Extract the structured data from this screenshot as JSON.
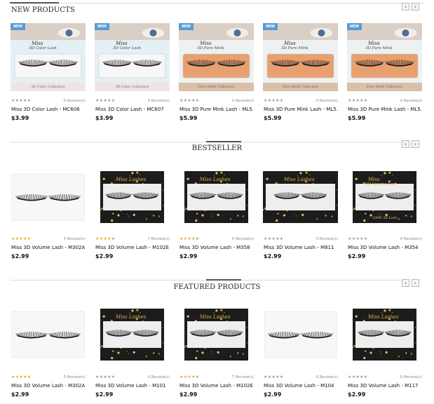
{
  "colors": {
    "badge": "#5a9ad6",
    "star_on": "#f5a623",
    "star_off": "#9a9a9a",
    "pkg_peach": "#e8a071",
    "gold": "#c79a2a"
  },
  "icons": {
    "prev": "‹",
    "next": "›",
    "star": "★"
  },
  "sections": [
    {
      "title": "NEW PRODUCTS",
      "products": [
        {
          "badge": "NEW",
          "brand": "Miss",
          "line": "3D Color Lash",
          "caption": "3D Color Collection",
          "rating": 0,
          "reviews": "0 Review(s)",
          "name": "Miss 3D Color Lash - MC608",
          "price": "$3.99"
        },
        {
          "badge": "NEW",
          "brand": "Miss",
          "line": "3D Color Lash",
          "caption": "3D Color Collection",
          "rating": 0,
          "reviews": "0 Review(s)",
          "name": "Miss 3D Color Lash - MC607",
          "price": "$3.99"
        },
        {
          "badge": "NEW",
          "brand": "Miss",
          "line": "3D Pure Mink",
          "caption": "Pure Mink Collection",
          "rating": 0,
          "reviews": "0 Review(s)",
          "name": "Miss 3D Pure Mink Lash - ML5...",
          "price": "$5.99"
        },
        {
          "badge": "NEW",
          "brand": "Miss",
          "line": "3D Pure Mink",
          "caption": "Pure Mink Collection",
          "rating": 0,
          "reviews": "0 Review(s)",
          "name": "Miss 3D Pure Mink Lash - ML5...",
          "price": "$5.99"
        },
        {
          "badge": "NEW",
          "brand": "Miss",
          "line": "3D Pure Mink",
          "caption": "Pure Mink Collection",
          "rating": 0,
          "reviews": "0 Review(s)",
          "name": "Miss 3D Pure Mink Lash - ML5...",
          "price": "$5.99"
        }
      ]
    },
    {
      "title": "BESTSELLER",
      "products": [
        {
          "brand": "",
          "line": "",
          "caption": "",
          "rating": 5,
          "reviews": "5 Review(s)",
          "name": "Miss 3D Volume Lash - M302A",
          "price": "$2.99"
        },
        {
          "brand": "Miss Lashes",
          "line": "",
          "caption": "",
          "rating": 4.5,
          "reviews": "7 Review(s)",
          "name": "Miss 3D Volume Lash - M102E",
          "price": "$2.99"
        },
        {
          "brand": "Miss Lashes",
          "line": "",
          "caption": "",
          "rating": 4.5,
          "reviews": "4 Review(s)",
          "name": "Miss 3D Volume Lash - M358",
          "price": "$2.99"
        },
        {
          "brand": "Miss Lashes",
          "line": "",
          "caption": "",
          "rating": 0,
          "reviews": "0 Review(s)",
          "name": "Miss 3D Volume Lash - M811",
          "price": "$2.99"
        },
        {
          "brand": "Miss",
          "line": "3D Volume Lash",
          "caption": "100% 3D Lash",
          "rating": 0,
          "reviews": "0 Review(s)",
          "name": "Miss 3D Volume Lash - M354",
          "price": "$2.99"
        }
      ]
    },
    {
      "title": "FEATURED PRODUCTS",
      "products": [
        {
          "brand": "",
          "line": "",
          "caption": "",
          "rating": 5,
          "reviews": "5 Review(s)",
          "name": "Miss 3D Volume Lash - M302A",
          "price": "$2.99"
        },
        {
          "brand": "Miss Lashes",
          "line": "",
          "caption": "",
          "rating": 0,
          "reviews": "0 Review(s)",
          "name": "Miss 3D Volume Lash - M101",
          "price": "$2.99"
        },
        {
          "brand": "Miss Lashes",
          "line": "",
          "caption": "",
          "rating": 4.5,
          "reviews": "7 Review(s)",
          "name": "Miss 3D Volume Lash - M102E",
          "price": "$2.99"
        },
        {
          "brand": "",
          "line": "",
          "caption": "",
          "rating": 0,
          "reviews": "0 Review(s)",
          "name": "Miss 3D Volume Lash - M104",
          "price": "$2.99"
        },
        {
          "brand": "Miss Lashes",
          "line": "",
          "caption": "",
          "rating": 0,
          "reviews": "0 Review(s)",
          "name": "Miss 3D Volume Lash - M117",
          "price": "$2.99"
        }
      ]
    }
  ]
}
